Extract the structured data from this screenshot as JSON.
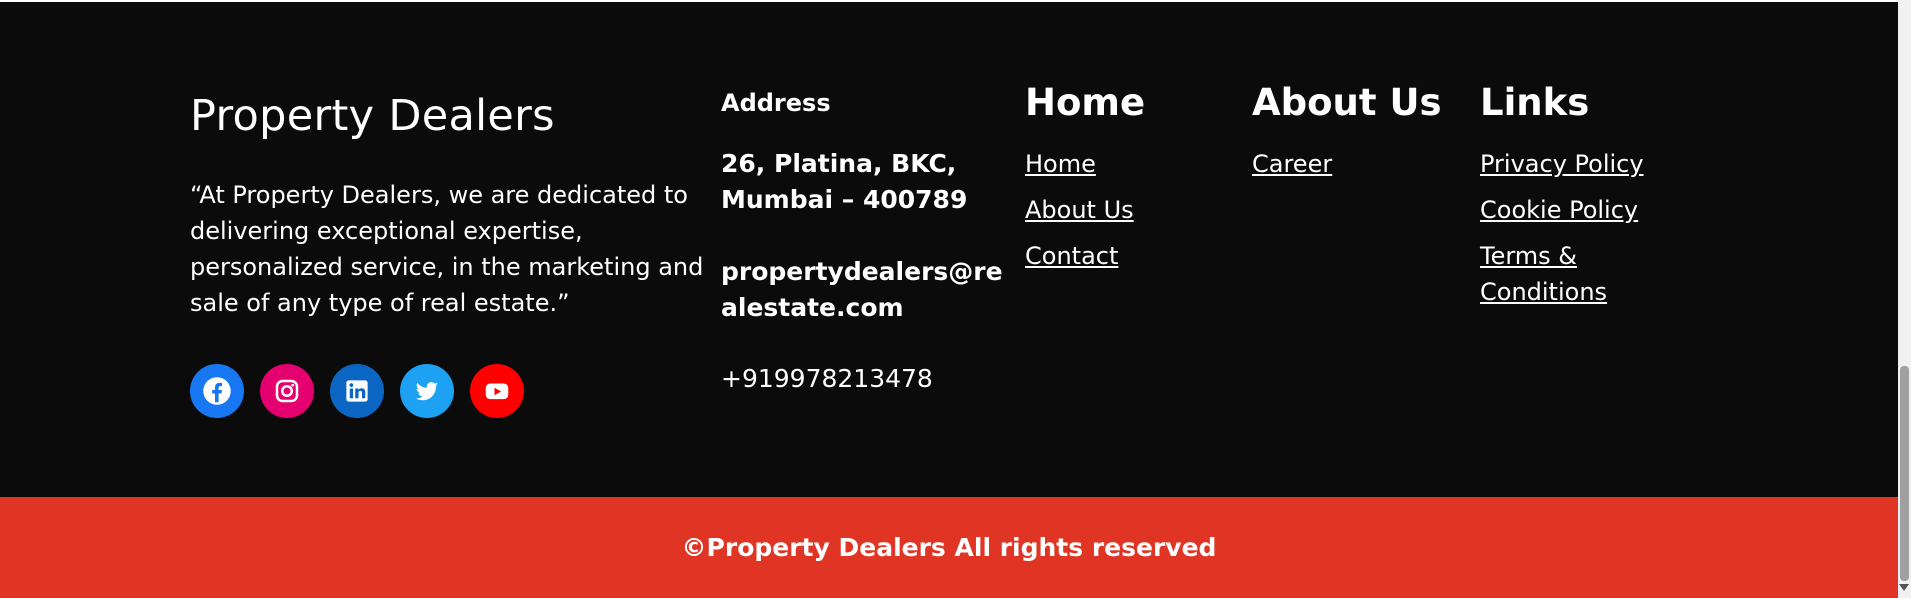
{
  "footer": {
    "brand": {
      "title": "Property Dealers",
      "description": "“At Property Dealers, we are dedicated to delivering exceptional expertise, personalized service, in the marketing and sale of any type of real estate.”"
    },
    "social": [
      {
        "name": "facebook-icon",
        "color": "#1877f2"
      },
      {
        "name": "instagram-icon",
        "color": "#e4006e"
      },
      {
        "name": "linkedin-icon",
        "color": "#0a66c2"
      },
      {
        "name": "twitter-icon",
        "color": "#1da1f2"
      },
      {
        "name": "youtube-icon",
        "color": "#ff0000"
      }
    ],
    "address": {
      "title": "Address",
      "line": "26, Platina, BKC, Mumbai – 400789",
      "email": "propertydealers@realestate.com",
      "phone": "+919978213478"
    },
    "home_col": {
      "title": "Home",
      "links": [
        "Home",
        "About Us",
        "Contact"
      ]
    },
    "about_col": {
      "title": "About Us",
      "links": [
        "Career"
      ]
    },
    "links_col": {
      "title": "Links",
      "links": [
        "Privacy Policy",
        "Cookie Policy",
        "Terms & Conditions"
      ]
    }
  },
  "copyright": "©Property Dealers All rights reserved",
  "colors": {
    "footer_bg": "#0b0b0b",
    "copyright_bg": "#e03524"
  }
}
